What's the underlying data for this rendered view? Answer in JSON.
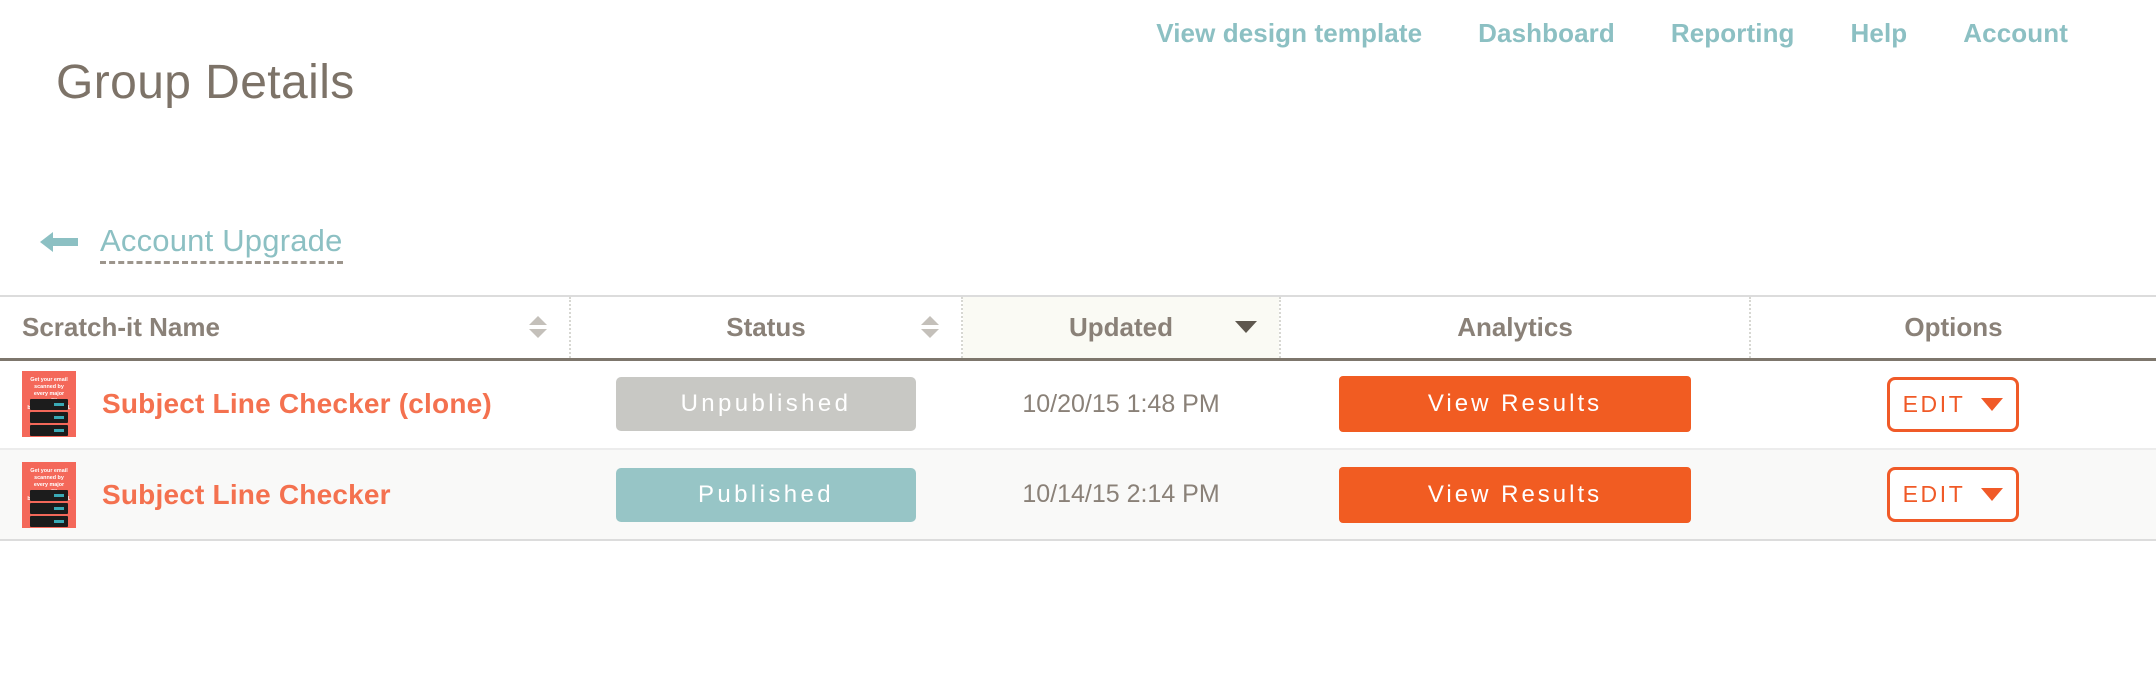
{
  "topnav": {
    "items": [
      {
        "label": "View design template",
        "name": "nav-view-design-template"
      },
      {
        "label": "Dashboard",
        "name": "nav-dashboard"
      },
      {
        "label": "Reporting",
        "name": "nav-reporting"
      },
      {
        "label": "Help",
        "name": "nav-help"
      },
      {
        "label": "Account",
        "name": "nav-account"
      }
    ],
    "color": "#8cc0c3"
  },
  "page": {
    "title": "Group Details"
  },
  "backlink": {
    "icon": "arrow-left-icon",
    "label": "Account Upgrade"
  },
  "table": {
    "columns": [
      {
        "label": "Scratch-it Name",
        "align": "left",
        "sort": "both",
        "active": false
      },
      {
        "label": "Status",
        "align": "center",
        "sort": "both",
        "active": false
      },
      {
        "label": "Updated",
        "align": "center",
        "sort": "desc",
        "active": true
      },
      {
        "label": "Analytics",
        "align": "center",
        "sort": "none",
        "active": false
      },
      {
        "label": "Options",
        "align": "center",
        "sort": "none",
        "active": false
      }
    ],
    "thumbnail_text": "Get your email scanned by every major spam filter before you send.",
    "rows": [
      {
        "title": "Subject Line Checker (clone)",
        "status": "Unpublished",
        "status_kind": "unpublished",
        "updated": "10/20/15 1:48 PM",
        "analytics_label": "View Results",
        "options_label": "EDIT"
      },
      {
        "title": "Subject Line Checker",
        "status": "Published",
        "status_kind": "published",
        "updated": "10/14/15 2:14 PM",
        "analytics_label": "View Results",
        "options_label": "EDIT"
      }
    ]
  },
  "colors": {
    "accent_orange": "#f15c22",
    "accent_teal": "#8cc0c3",
    "published_teal": "#97c5c6",
    "unpublished_gray": "#c8c8c4",
    "title_orange": "#f4714f",
    "text_brown": "#8a8178"
  }
}
